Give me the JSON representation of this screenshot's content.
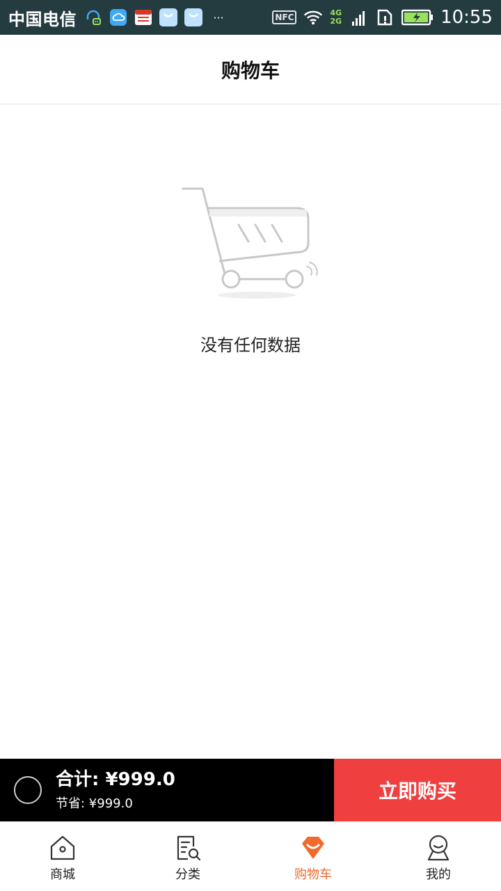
{
  "status_bar": {
    "carrier": "中国电信",
    "nfc": "NFC",
    "net_top": "4G",
    "net_bottom": "2G",
    "time": "10:55",
    "more": "···"
  },
  "header": {
    "title": "购物车"
  },
  "empty_state": {
    "icon": "shopping-cart-icon",
    "message": "没有任何数据"
  },
  "checkout": {
    "total_label": "合计: ¥999.0",
    "savings_label": "节省: ¥999.0",
    "buy_label": "立即购买"
  },
  "tabs": [
    {
      "label": "商城",
      "icon": "home-icon",
      "active": false
    },
    {
      "label": "分类",
      "icon": "category-search-icon",
      "active": false
    },
    {
      "label": "购物车",
      "icon": "cart-tab-icon",
      "active": true
    },
    {
      "label": "我的",
      "icon": "user-icon",
      "active": false
    }
  ],
  "colors": {
    "status_bar": "#243b40",
    "accent": "#ef6a2b",
    "buy_button": "#f03f3f",
    "checkout_bg": "#000000"
  }
}
